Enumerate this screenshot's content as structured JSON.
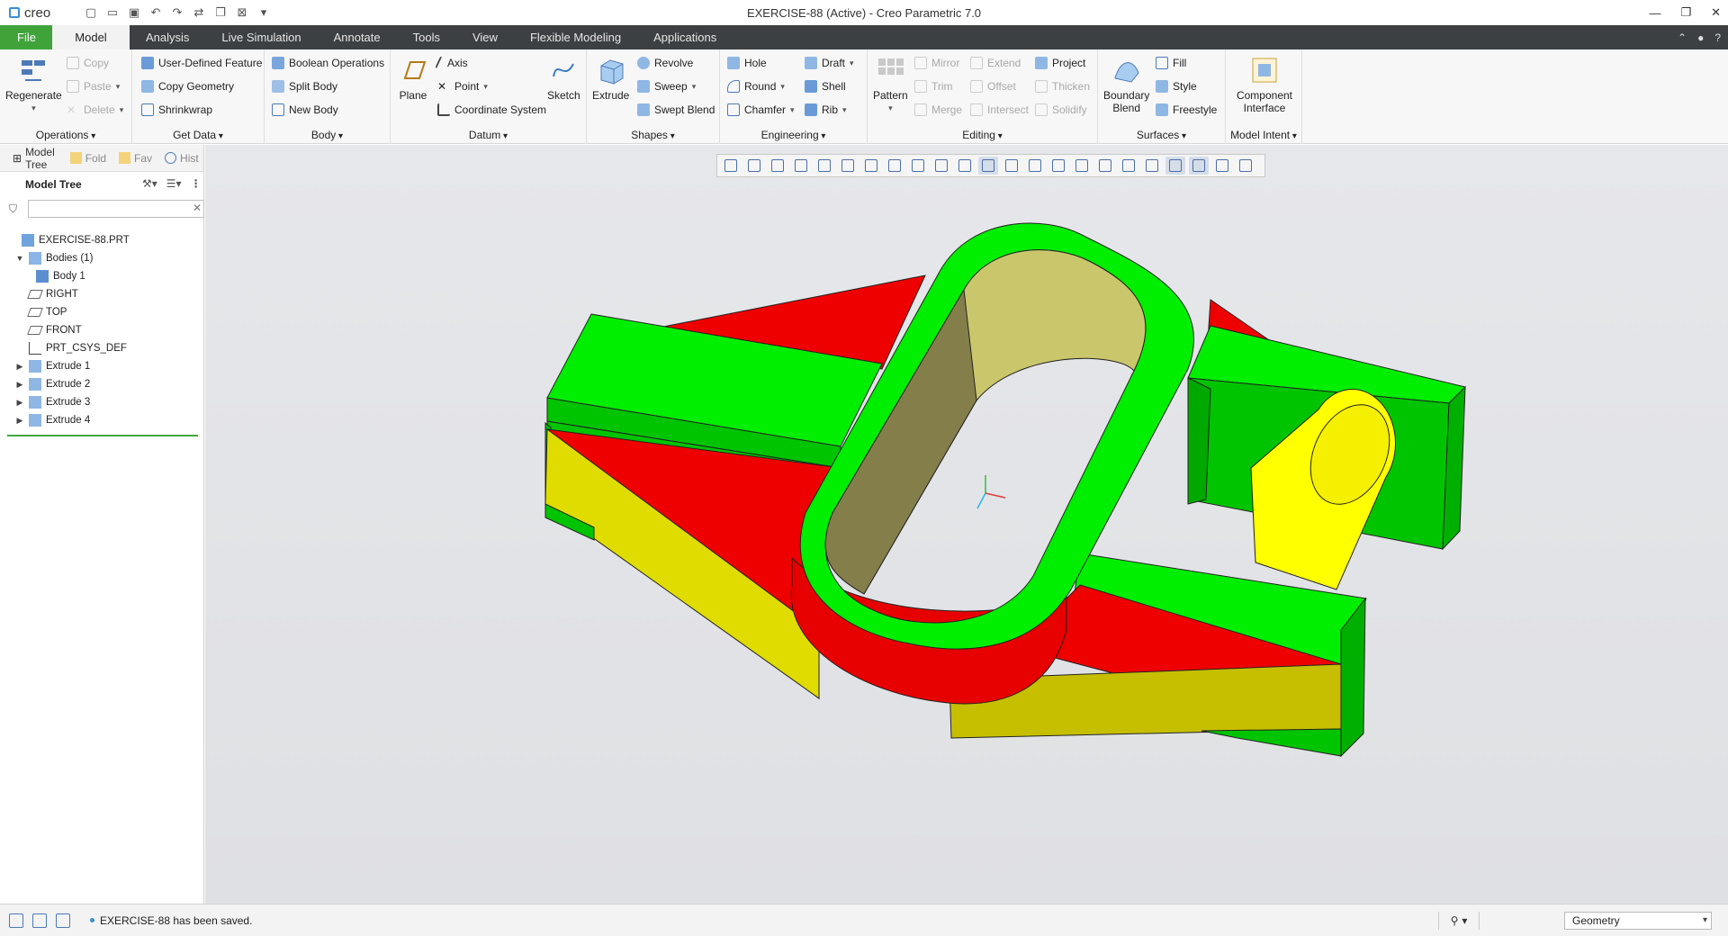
{
  "app": {
    "brand": "creo",
    "window_title": "EXERCISE-88 (Active) - Creo Parametric 7.0"
  },
  "menu": {
    "tabs": [
      "File",
      "Model",
      "Analysis",
      "Live Simulation",
      "Annotate",
      "Tools",
      "View",
      "Flexible Modeling",
      "Applications"
    ],
    "active": "Model"
  },
  "ribbon": {
    "operations": {
      "label": "Operations",
      "regenerate": "Regenerate",
      "copy": "Copy",
      "paste": "Paste",
      "delete": "Delete"
    },
    "get_data": {
      "label": "Get Data",
      "udf": "User-Defined Feature",
      "copy_geometry": "Copy Geometry",
      "shrinkwrap": "Shrinkwrap"
    },
    "body": {
      "label": "Body",
      "boolean": "Boolean Operations",
      "split": "Split Body",
      "new": "New Body"
    },
    "datum": {
      "label": "Datum",
      "plane": "Plane",
      "axis": "Axis",
      "point": "Point",
      "csys": "Coordinate System",
      "sketch": "Sketch"
    },
    "shapes": {
      "label": "Shapes",
      "extrude": "Extrude",
      "revolve": "Revolve",
      "sweep": "Sweep",
      "swept_blend": "Swept Blend"
    },
    "engineering": {
      "label": "Engineering",
      "hole": "Hole",
      "round": "Round",
      "chamfer": "Chamfer",
      "draft": "Draft",
      "shell": "Shell",
      "rib": "Rib"
    },
    "editing": {
      "label": "Editing",
      "pattern": "Pattern",
      "mirror": "Mirror",
      "trim": "Trim",
      "merge": "Merge",
      "extend": "Extend",
      "offset": "Offset",
      "intersect": "Intersect",
      "project": "Project",
      "thicken": "Thicken",
      "solidify": "Solidify"
    },
    "surfaces": {
      "label": "Surfaces",
      "boundary_blend_1": "Boundary",
      "boundary_blend_2": "Blend",
      "fill": "Fill",
      "style": "Style",
      "freestyle": "Freestyle"
    },
    "model_intent": {
      "label": "Model Intent",
      "component_1": "Component",
      "component_2": "Interface"
    }
  },
  "panel": {
    "tabs": [
      "Model Tree",
      "Fold",
      "Fav",
      "Hist"
    ],
    "header": "Model Tree",
    "search_placeholder": "",
    "tree": [
      {
        "label": "EXERCISE-88.PRT",
        "level": 0,
        "icon": "part-icon",
        "expander": ""
      },
      {
        "label": "Bodies (1)",
        "level": 1,
        "icon": "bodies-icon",
        "expander": "▼"
      },
      {
        "label": "Body 1",
        "level": 2,
        "icon": "body-icon",
        "expander": ""
      },
      {
        "label": "RIGHT",
        "level": 1,
        "icon": "datum-plane-icon",
        "expander": ""
      },
      {
        "label": "TOP",
        "level": 1,
        "icon": "datum-plane-icon",
        "expander": ""
      },
      {
        "label": "FRONT",
        "level": 1,
        "icon": "datum-plane-icon",
        "expander": ""
      },
      {
        "label": "PRT_CSYS_DEF",
        "level": 1,
        "icon": "csys-icon",
        "expander": ""
      },
      {
        "label": "Extrude 1",
        "level": 1,
        "icon": "extrude-icon",
        "expander": "▶"
      },
      {
        "label": "Extrude 2",
        "level": 1,
        "icon": "extrude-icon",
        "expander": "▶"
      },
      {
        "label": "Extrude 3",
        "level": 1,
        "icon": "extrude-icon",
        "expander": "▶"
      },
      {
        "label": "Extrude 4",
        "level": 1,
        "icon": "extrude-icon",
        "expander": "▶"
      }
    ]
  },
  "status": {
    "message": "EXERCISE-88 has been saved.",
    "filter_value": "Geometry"
  },
  "colors": {
    "green": "#00ee00",
    "green_dark": "#00b800",
    "red": "#ee0000",
    "yellow": "#e5e000",
    "accent": "#3fa33a",
    "menubar": "#3c4043"
  }
}
